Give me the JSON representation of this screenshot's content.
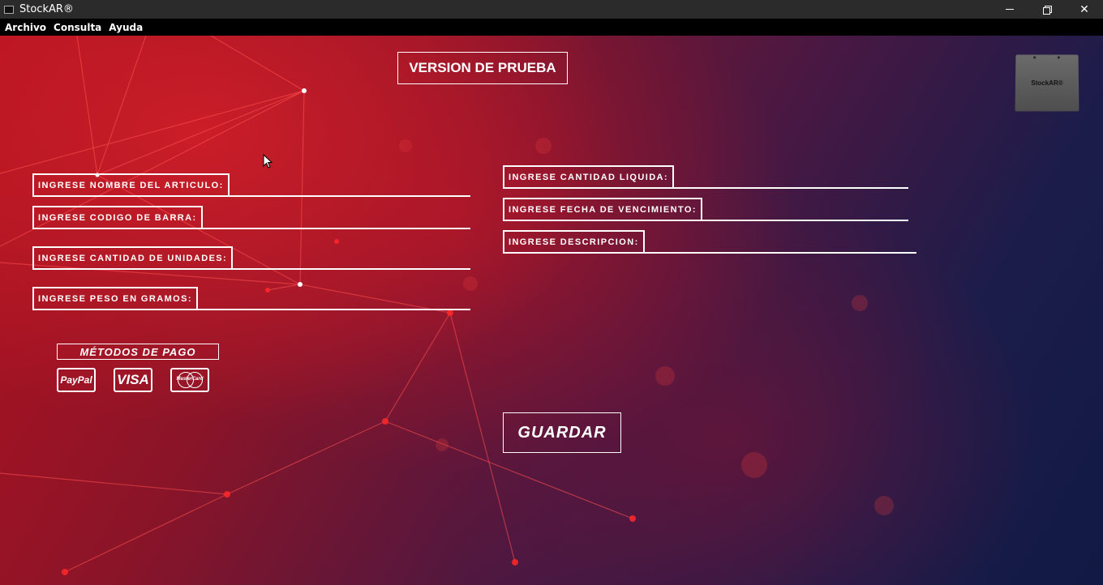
{
  "window": {
    "title": "StockAR®",
    "minimize_icon": "minimize-icon",
    "restore_icon": "restore-icon",
    "close_symbol": "✕"
  },
  "menu": [
    "Archivo",
    "Consulta",
    "Ayuda"
  ],
  "banner": "VERSION DE PRUEBA",
  "logo_text": "StockAR®",
  "fields_left": [
    {
      "label": "INGRESE NOMBRE DEL ARTICULO:",
      "value": ""
    },
    {
      "label": "INGRESE CODIGO DE BARRA:",
      "value": ""
    },
    {
      "label": "INGRESE CANTIDAD DE UNIDADES:",
      "value": ""
    },
    {
      "label": "INGRESE PESO EN GRAMOS:",
      "value": ""
    }
  ],
  "fields_right": [
    {
      "label": "INGRESE CANTIDAD LIQUIDA:",
      "value": ""
    },
    {
      "label": "INGRESE FECHA DE VENCIMIENTO:",
      "value": ""
    },
    {
      "label": "INGRESE DESCRIPCION:",
      "value": ""
    }
  ],
  "payment": {
    "title": "MÉTODOS DE  PAGO",
    "methods": [
      "PayPal",
      "VISA",
      "MasterCard"
    ]
  },
  "save_label": "GUARDAR",
  "colors": {
    "titlebar": "#2b2b2b",
    "menubar": "#000000",
    "accent_red": "#d11a2a",
    "deep_blue": "#111a44",
    "text": "#ffffff"
  }
}
